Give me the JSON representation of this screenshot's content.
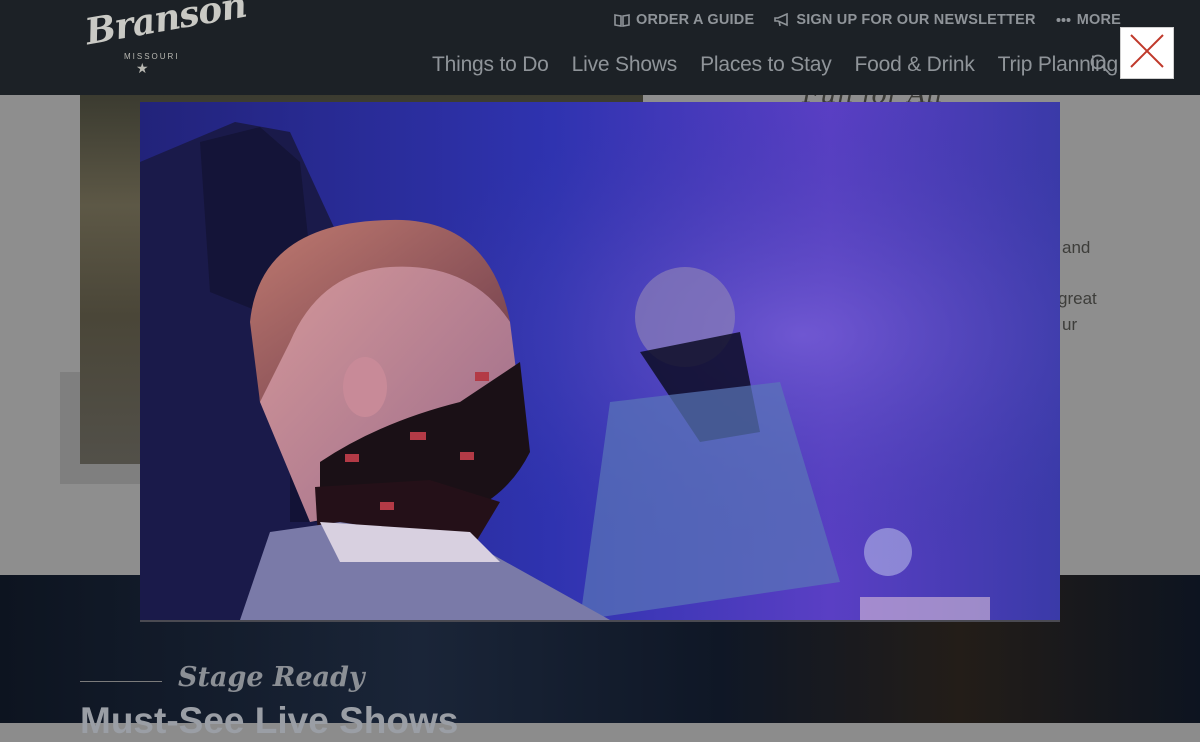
{
  "brand": {
    "logo_word": "Branson",
    "logo_sub": "MISSOURI"
  },
  "utility_nav": {
    "order_guide": "ORDER A GUIDE",
    "newsletter": "SIGN UP FOR OUR NEWSLETTER",
    "more": "MORE"
  },
  "main_nav": {
    "items": [
      {
        "label": "Things to Do"
      },
      {
        "label": "Live Shows"
      },
      {
        "label": "Places to Stay"
      },
      {
        "label": "Food & Drink"
      },
      {
        "label": "Trip Planning"
      }
    ]
  },
  "icons": {
    "order_guide": "book-icon",
    "newsletter": "megaphone-icon",
    "more": "ellipsis-icon",
    "search": "search-icon",
    "close": "close-icon"
  },
  "background": {
    "heading_fragment": "Fun for All",
    "text_fragments": [
      "and",
      "great",
      "ur"
    ]
  },
  "band": {
    "kicker": "Stage Ready",
    "title": "Must-See Live Shows"
  },
  "colors": {
    "header_bg": "#1c2126",
    "nav_text": "#8f9499",
    "close_x": "#c0392b",
    "modal_tint": "#2b2a8a"
  }
}
